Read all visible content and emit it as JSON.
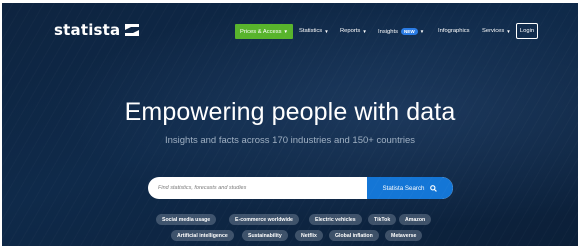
{
  "header": {
    "logo_text": "statista",
    "prices_label": "Prices & Access",
    "nav": [
      {
        "label": "Statistics"
      },
      {
        "label": "Reports"
      },
      {
        "label": "Insights",
        "badge": "NEW"
      },
      {
        "label": "Infographics"
      },
      {
        "label": "Services"
      }
    ],
    "login_label": "Login"
  },
  "hero": {
    "headline": "Empowering people with data",
    "subline": "Insights and facts across 170 industries and 150+ countries"
  },
  "search": {
    "placeholder": "Find statistics, forecasts and studies",
    "button_label": "Statista Search",
    "button_icon": "search-icon"
  },
  "tags_row1": [
    "Social media usage",
    "E-commerce worldwide",
    "Electric vehicles",
    "TikTok",
    "Amazon"
  ],
  "tags_row2": [
    "Artificial intelligence",
    "Sustainability",
    "Netflix",
    "Global inflation",
    "Metaverse"
  ],
  "colors": {
    "background": "#0f2a4a",
    "prices_button": "#58b42c",
    "search_button": "#1476d6",
    "new_badge": "#2a7be4"
  }
}
